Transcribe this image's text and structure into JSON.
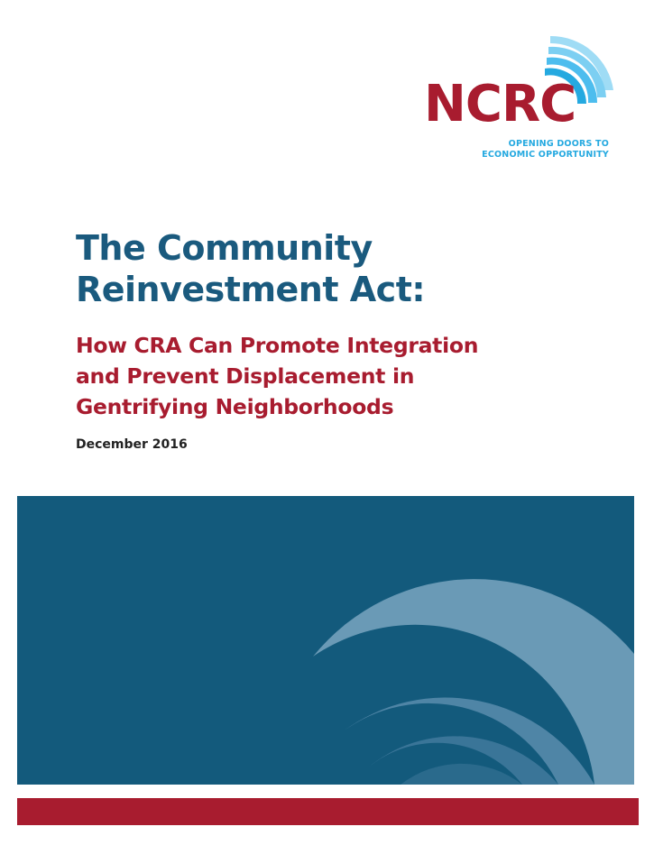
{
  "logo": {
    "wordmark": "NCRC",
    "tagline_line1": "OPENING DOORS TO",
    "tagline_line2": "ECONOMIC OPPORTUNITY",
    "colors": {
      "wordmark": "#a81c2f",
      "waves": "#25a9e0"
    }
  },
  "title": {
    "line1": "The Community",
    "line2": "Reinvestment Act:"
  },
  "subtitle": {
    "line1": "How CRA Can Promote Integration",
    "line2": "and Prevent Displacement in",
    "line3": "Gentrifying Neighborhoods"
  },
  "date": "December 2016",
  "colors": {
    "title": "#1a5a7e",
    "subtitle": "#a81c2f",
    "panel": "#135a7c",
    "footer_bar": "#a81c2f"
  }
}
